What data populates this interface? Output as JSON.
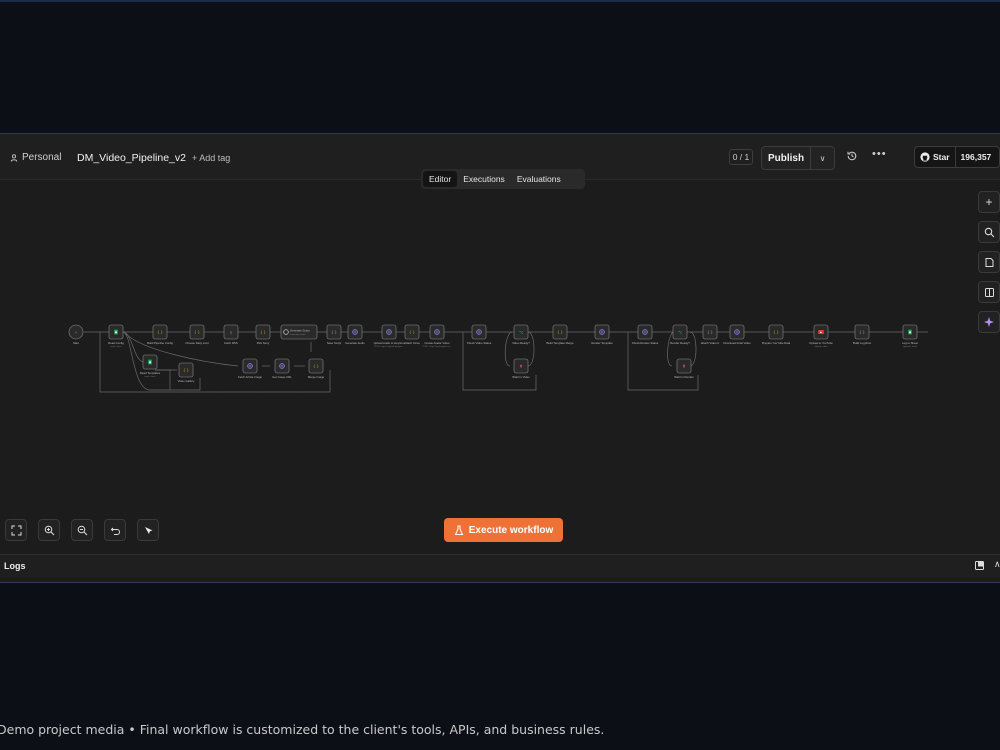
{
  "header": {
    "project": "Personal",
    "workflow_name": "DM_Video_Pipeline_v2",
    "add_tag": "+ Add tag",
    "counter": "0 / 1",
    "publish": "Publish",
    "github_star": "Star",
    "github_count": "196,357"
  },
  "tabs": [
    "Editor",
    "Executions",
    "Evaluations"
  ],
  "actions": {
    "execute": "Execute workflow"
  },
  "logs": {
    "label": "Logs"
  },
  "caption": "Demo project media • Final workflow is customized to the client's tools, APIs, and business rules.",
  "colors": {
    "accent": "#ee7136",
    "canvas": "#1c1c1c",
    "page": "#0d0f17"
  },
  "nodes": [
    {
      "label": "Start",
      "sub": "",
      "icon": "trigger-icon"
    },
    {
      "label": "Read Config",
      "sub": "read: sheet",
      "icon": "sheets-icon"
    },
    {
      "label": "Build Pipeline Config",
      "sub": "",
      "icon": "code-icon"
    },
    {
      "label": "Choose Daily Limit",
      "sub": "",
      "icon": "code-icon"
    },
    {
      "label": "Fetch RSS",
      "sub": "",
      "icon": "rss-icon"
    },
    {
      "label": "Pick Story",
      "sub": "",
      "icon": "code-icon"
    },
    {
      "label": "Generate Script",
      "sub": "message model",
      "icon": "openai-icon"
    },
    {
      "label": "Save Script",
      "sub": "",
      "icon": "code-icon"
    },
    {
      "label": "Generate Audio",
      "sub": "",
      "icon": "http-icon"
    },
    {
      "label": "Upload Audio to HeyGen",
      "sub": "POST: https://upload.heygen...",
      "icon": "http-icon"
    },
    {
      "label": "Attach Voice",
      "sub": "",
      "icon": "code-icon"
    },
    {
      "label": "Create Avatar Video",
      "sub": "POST: https://api.heygen.co...",
      "icon": "http-icon"
    },
    {
      "label": "Check Video Status",
      "sub": "",
      "icon": "http-icon"
    },
    {
      "label": "Video Ready?",
      "sub": "",
      "icon": "switch-icon"
    },
    {
      "label": "Build Template Merge",
      "sub": "",
      "icon": "code-icon"
    },
    {
      "label": "Render Template",
      "sub": "",
      "icon": "http-icon"
    },
    {
      "label": "Check Render Status",
      "sub": "",
      "icon": "http-icon"
    },
    {
      "label": "Render Ready?",
      "sub": "",
      "icon": "switch-icon"
    },
    {
      "label": "Attach Video U",
      "sub": "",
      "icon": "code-icon"
    },
    {
      "label": "Download Final Video",
      "sub": "",
      "icon": "http-icon"
    },
    {
      "label": "Prepare YouTube Data",
      "sub": "",
      "icon": "code-icon"
    },
    {
      "label": "Upload to YouTube",
      "sub": "upload: video",
      "icon": "youtube-icon"
    },
    {
      "label": "Build Log Row",
      "sub": "",
      "icon": "code-icon"
    },
    {
      "label": "Log to Sheet",
      "sub": "append: sheet",
      "icon": "sheets-icon"
    },
    {
      "label": "Read Templates",
      "sub": "read: sheet",
      "icon": "sheets-icon"
    },
    {
      "label": "Video Gallery",
      "sub": "",
      "icon": "code-icon"
    },
    {
      "label": "Fetch Article Image",
      "sub": "",
      "icon": "http-icon"
    },
    {
      "label": "Get Image URL",
      "sub": "",
      "icon": "http-icon"
    },
    {
      "label": "Merge Image",
      "sub": "",
      "icon": "code-icon"
    },
    {
      "label": "Wait for Video",
      "sub": "",
      "icon": "wait-icon"
    },
    {
      "label": "Wait for Render",
      "sub": "",
      "icon": "wait-icon"
    }
  ]
}
